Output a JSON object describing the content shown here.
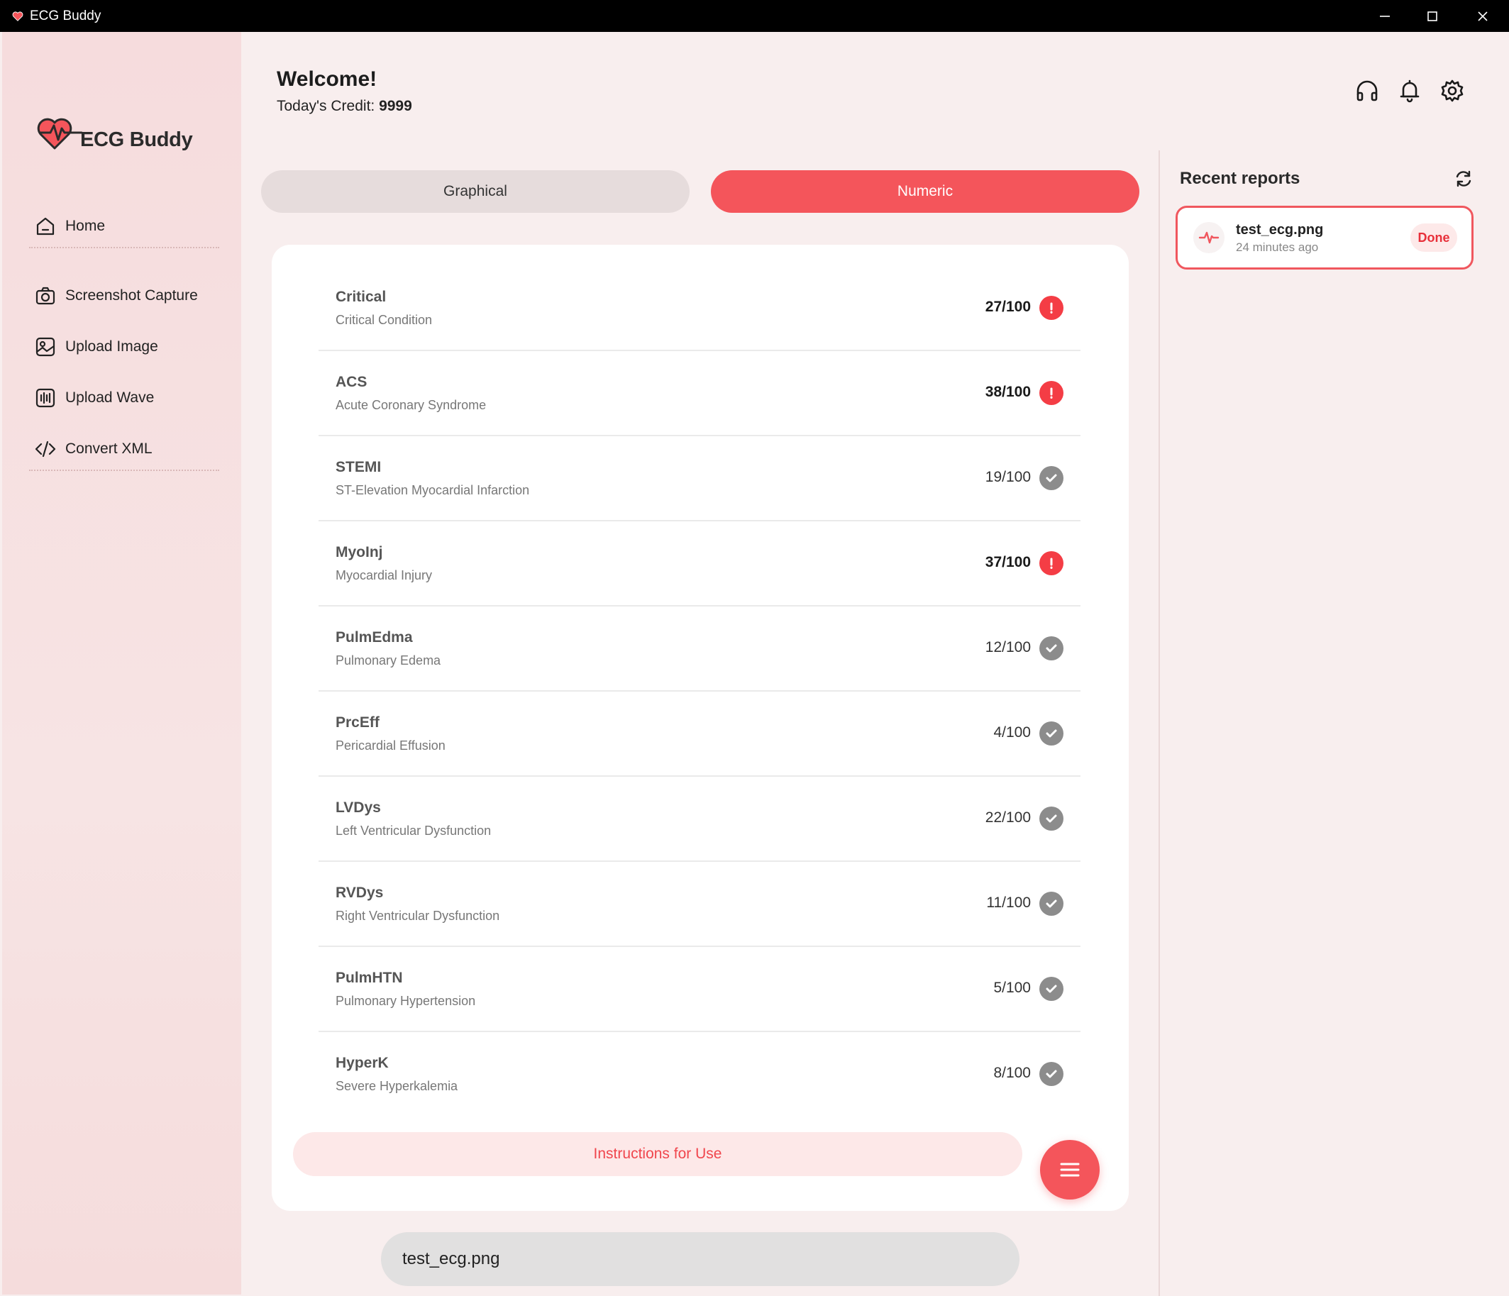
{
  "window": {
    "title": "ECG Buddy"
  },
  "brand": {
    "name": "ECG Buddy",
    "accent": "#f4555b"
  },
  "sidebar": {
    "items": [
      {
        "label": "Home",
        "icon": "home-icon"
      },
      {
        "label": "Screenshot Capture",
        "icon": "camera-icon"
      },
      {
        "label": "Upload Image",
        "icon": "image-icon"
      },
      {
        "label": "Upload Wave",
        "icon": "wave-icon"
      },
      {
        "label": "Convert XML",
        "icon": "code-icon"
      }
    ]
  },
  "header": {
    "welcome": "Welcome!",
    "credit_label": "Today's Credit: ",
    "credit_value": "9999"
  },
  "tabs": [
    {
      "label": "Graphical",
      "active": false
    },
    {
      "label": "Numeric",
      "active": true
    }
  ],
  "results": [
    {
      "code": "Critical",
      "desc": "Critical Condition",
      "score": "27/100",
      "status": "alert"
    },
    {
      "code": "ACS",
      "desc": "Acute Coronary Syndrome",
      "score": "38/100",
      "status": "alert"
    },
    {
      "code": "STEMI",
      "desc": "ST-Elevation Myocardial Infarction",
      "score": "19/100",
      "status": "ok"
    },
    {
      "code": "MyoInj",
      "desc": "Myocardial Injury",
      "score": "37/100",
      "status": "alert"
    },
    {
      "code": "PulmEdma",
      "desc": "Pulmonary Edema",
      "score": "12/100",
      "status": "ok"
    },
    {
      "code": "PrcEff",
      "desc": "Pericardial Effusion",
      "score": "4/100",
      "status": "ok"
    },
    {
      "code": "LVDys",
      "desc": "Left Ventricular Dysfunction",
      "score": "22/100",
      "status": "ok"
    },
    {
      "code": "RVDys",
      "desc": "Right Ventricular Dysfunction",
      "score": "11/100",
      "status": "ok"
    },
    {
      "code": "PulmHTN",
      "desc": "Pulmonary Hypertension",
      "score": "5/100",
      "status": "ok"
    },
    {
      "code": "HyperK",
      "desc": "Severe Hyperkalemia",
      "score": "8/100",
      "status": "ok"
    }
  ],
  "instructions_label": "Instructions for Use",
  "file_name": "test_ecg.png",
  "recent": {
    "title": "Recent reports",
    "reports": [
      {
        "name": "test_ecg.png",
        "time": "24 minutes ago",
        "status": "Done"
      }
    ]
  }
}
